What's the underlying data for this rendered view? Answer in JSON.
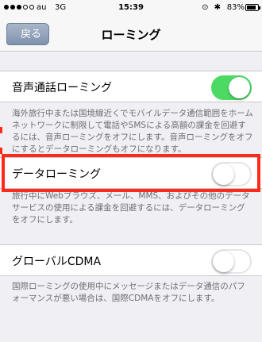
{
  "status_bar": {
    "carrier": "au",
    "network": "3G",
    "time": "15:39",
    "icons": "⊙ ✱",
    "battery_pct": "83%",
    "battery_level": 0.83
  },
  "nav": {
    "back_label": "戻る",
    "title": "ローミング"
  },
  "voice_roaming": {
    "label": "音声通話ローミング",
    "on": true,
    "note": "海外旅行中または国境線近くでモバイルデータ通信範囲をホームネットワークに制限して電話やSMSによる高額の課金を回避するには、音声ローミングをオフにします。音声ローミングをオフにするとデータローミングもオフになります。"
  },
  "data_roaming": {
    "label": "データローミング",
    "on": false,
    "note": "旅行中にWebブラウズ、メール、MMS、およびその他のデータサービスの使用による課金を回避するには、データローミングをオフにします。"
  },
  "global_cdma": {
    "label": "グローバルCDMA",
    "on": false,
    "note": "国際ローミングの使用中にメッセージまたはデータ通信のパフォーマンスが悪い場合は、国際CDMAをオフにします。"
  },
  "colors": {
    "highlight": "#ff2a1a",
    "toggle_on": "#4cd964"
  }
}
